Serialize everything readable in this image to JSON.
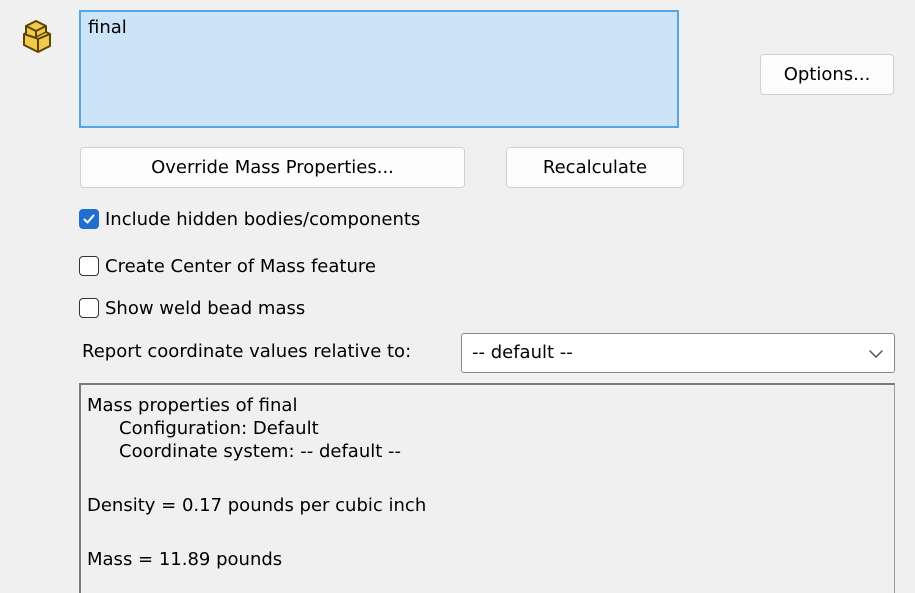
{
  "selection": {
    "items": [
      "final"
    ]
  },
  "buttons": {
    "options": "Options...",
    "override": "Override Mass Properties...",
    "recalculate": "Recalculate"
  },
  "checkboxes": {
    "include_hidden": {
      "label": "Include hidden bodies/components",
      "checked": true
    },
    "create_com": {
      "label": "Create Center of Mass feature",
      "checked": false
    },
    "weld_bead": {
      "label": "Show weld bead mass",
      "checked": false
    }
  },
  "coordinates": {
    "label": "Report coordinate values relative to:",
    "selected": "-- default --"
  },
  "results": {
    "heading": "Mass properties of final",
    "configuration": "Configuration: Default",
    "coordinate_system": "Coordinate system: -- default --",
    "density": "Density = 0.17 pounds per cubic inch",
    "mass": "Mass = 11.89 pounds"
  },
  "colors": {
    "selection_bg": "#cce4f7",
    "selection_border": "#56a5e4",
    "checkbox_checked": "#1f6fd0",
    "icon_fill": "#f2c94c"
  },
  "icons": {
    "part": "part-component-icon",
    "dropdown": "chevron-down-icon",
    "check": "checkmark-icon"
  }
}
